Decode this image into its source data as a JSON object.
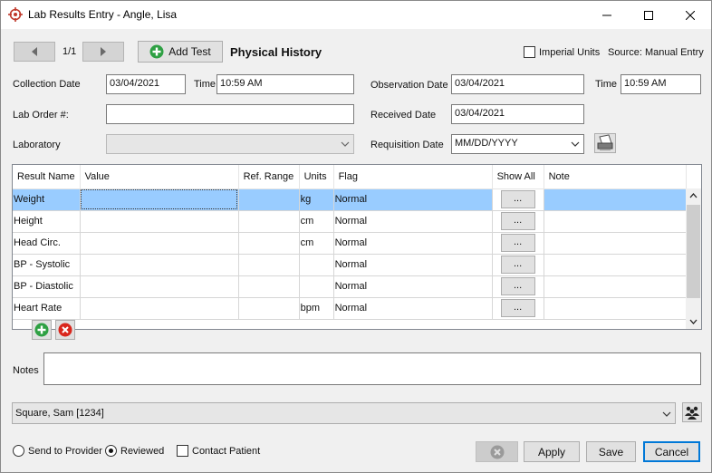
{
  "window": {
    "title": "Lab Results Entry - Angle, Lisa",
    "minimize_icon": "minimize-icon",
    "maximize_icon": "maximize-icon",
    "close_icon": "close-icon"
  },
  "toolbar": {
    "page_indicator": "1/1",
    "add_test_label": "Add Test",
    "panel_title": "Physical History",
    "imperial_units_label": "Imperial Units",
    "imperial_units_checked": false,
    "source_label": "Source: Manual Entry"
  },
  "form": {
    "collection_date_label": "Collection Date",
    "collection_date": "03/04/2021",
    "time_label": "Time",
    "collection_time": "10:59 AM",
    "observation_date_label": "Observation Date",
    "observation_date": "03/04/2021",
    "observation_time_label": "Time",
    "observation_time": "10:59 AM",
    "lab_order_label": "Lab Order #:",
    "lab_order": "",
    "received_date_label": "Received Date",
    "received_date": "03/04/2021",
    "laboratory_label": "Laboratory",
    "laboratory": "",
    "requisition_date_label": "Requisition Date",
    "requisition_date": "MM/DD/YYYY"
  },
  "grid": {
    "columns": [
      "Result Name",
      "Value",
      "Ref. Range",
      "Units",
      "Flag",
      "Show All",
      "Note"
    ],
    "ellipsis": "...",
    "rows": [
      {
        "name": "Weight",
        "value": "",
        "ref": "",
        "units": "kg",
        "flag": "Normal",
        "note": "",
        "selected": true
      },
      {
        "name": "Height",
        "value": "",
        "ref": "",
        "units": "cm",
        "flag": "Normal",
        "note": ""
      },
      {
        "name": "Head Circ.",
        "value": "",
        "ref": "",
        "units": "cm",
        "flag": "Normal",
        "note": ""
      },
      {
        "name": "BP - Systolic",
        "value": "",
        "ref": "",
        "units": "",
        "flag": "Normal",
        "note": ""
      },
      {
        "name": "BP - Diastolic",
        "value": "",
        "ref": "",
        "units": "",
        "flag": "Normal",
        "note": ""
      },
      {
        "name": "Heart Rate",
        "value": "",
        "ref": "",
        "units": "bpm",
        "flag": "Normal",
        "note": ""
      }
    ]
  },
  "notes": {
    "label": "Notes",
    "value": ""
  },
  "provider": {
    "selected": "Square, Sam [1234]"
  },
  "footer": {
    "send_to_provider_label": "Send to Provider",
    "reviewed_label": "Reviewed",
    "status_selected": "Reviewed",
    "contact_patient_label": "Contact Patient",
    "contact_patient_checked": false,
    "apply_label": "Apply",
    "save_label": "Save",
    "cancel_label": "Cancel"
  },
  "colors": {
    "selection": "#99ccff",
    "accent": "#0078d7",
    "add_green": "#2ea043",
    "delete_red": "#d9261c"
  }
}
